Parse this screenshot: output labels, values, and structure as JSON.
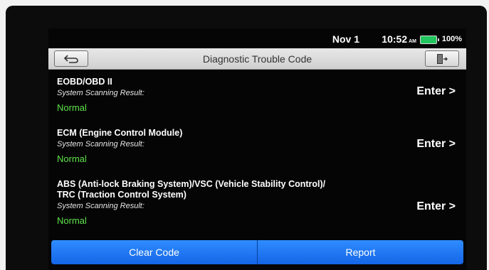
{
  "status": {
    "date": "Nov 1",
    "time": "10:52",
    "ampm": "AM",
    "battery": "100%"
  },
  "header": {
    "title": "Diagnostic Trouble Code",
    "back_icon": "back-arrow-icon",
    "exit_icon": "exit-door-icon"
  },
  "systems": [
    {
      "name": "EOBD/OBD II",
      "result_label": "System Scanning Result:",
      "result": "Normal",
      "action": "Enter >"
    },
    {
      "name": "ECM (Engine Control Module)",
      "result_label": "System Scanning Result:",
      "result": "Normal",
      "action": "Enter >"
    },
    {
      "name": "ABS (Anti-lock Braking System)/VSC (Vehicle Stability Control)/\nTRC (Traction Control System)",
      "result_label": "System Scanning Result:",
      "result": "Normal",
      "action": "Enter >"
    }
  ],
  "footer": {
    "clear_label": "Clear Code",
    "report_label": "Report"
  },
  "colors": {
    "accent": "#1f74f2",
    "normal": "#5ee24a",
    "battery": "#22c55e"
  }
}
